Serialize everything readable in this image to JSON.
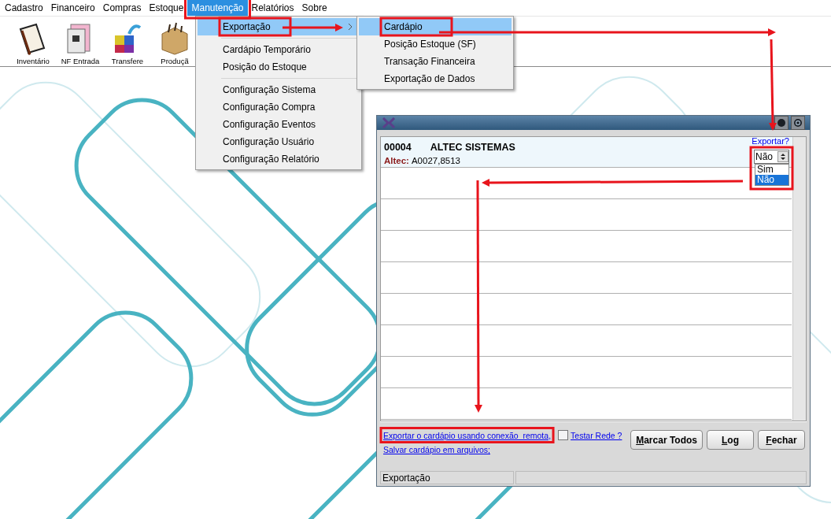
{
  "menu_bar": [
    {
      "label": "Cadastro",
      "selected": false
    },
    {
      "label": "Financeiro",
      "selected": false
    },
    {
      "label": "Compras",
      "selected": false
    },
    {
      "label": "Estoque",
      "selected": false
    },
    {
      "label": "Manutenção",
      "selected": true
    },
    {
      "label": "Relatórios",
      "selected": false
    },
    {
      "label": "Sobre",
      "selected": false
    }
  ],
  "toolbar": [
    {
      "label": "Inventário",
      "kind": "book"
    },
    {
      "label": "NF Entrada",
      "kind": "document"
    },
    {
      "label": "Transfere",
      "kind": "cubes"
    },
    {
      "label": "Produçã",
      "kind": "box"
    }
  ],
  "menu": {
    "items": [
      {
        "kind": "item",
        "label": "Exportação",
        "selected": true,
        "has_submenu": true
      },
      {
        "kind": "separator"
      },
      {
        "kind": "item",
        "label": "Cardápio Temporário",
        "selected": false
      },
      {
        "kind": "item",
        "label": "Posição do Estoque",
        "selected": false
      },
      {
        "kind": "separator"
      },
      {
        "kind": "item",
        "label": "Configuração Sistema",
        "selected": false
      },
      {
        "kind": "item",
        "label": "Configuração Compra",
        "selected": false
      },
      {
        "kind": "item",
        "label": "Configuração Eventos",
        "selected": false
      },
      {
        "kind": "item",
        "label": "Configuração Usuário",
        "selected": false
      },
      {
        "kind": "item",
        "label": "Configuração Relatório",
        "selected": false
      }
    ]
  },
  "submenu": {
    "items": [
      {
        "label": "Cardápio",
        "selected": true
      },
      {
        "label": "Posição Estoque (SF)",
        "selected": false
      },
      {
        "label": "Transação Financeira",
        "selected": false
      },
      {
        "label": "Exportação de Dados",
        "selected": false
      }
    ]
  },
  "dialog": {
    "rows": [
      {
        "code": "00004",
        "name": "ALTEC SISTEMAS",
        "field_label": "Altec:",
        "field_value": "A0027,8513",
        "selected": true,
        "export_label": "Exportar?",
        "export_value": "Não",
        "options": [
          {
            "label": "Sim",
            "selected": false
          },
          {
            "label": "Não",
            "selected": true
          }
        ]
      }
    ],
    "links": [
      "Exportar o cardápio usando conexão  remota,",
      "Salvar cardápio em arquivos;"
    ],
    "checkbox": {
      "label": "Testar Rede ?",
      "checked": false
    },
    "buttons": [
      "Marcar Todos",
      "Log",
      "Fechar"
    ],
    "status_bar": [
      "Exportação"
    ]
  }
}
